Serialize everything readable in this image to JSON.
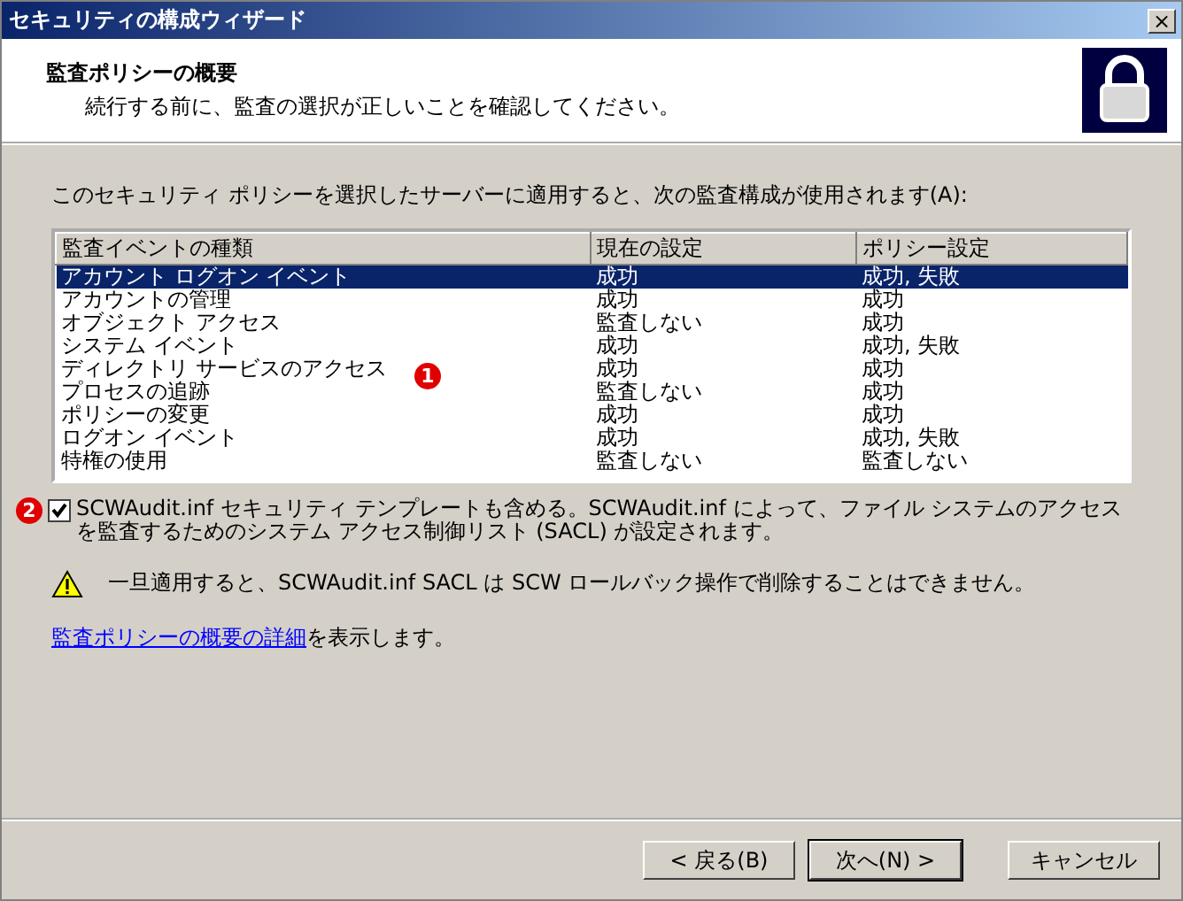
{
  "window": {
    "title": "セキュリティの構成ウィザード",
    "close": "×"
  },
  "header": {
    "title": "監査ポリシーの概要",
    "subtitle": "続行する前に、監査の選択が正しいことを確認してください。"
  },
  "intro": "このセキュリティ ポリシーを選択したサーバーに適用すると、次の監査構成が使用されます(A):",
  "table": {
    "columns": [
      "監査イベントの種類",
      "現在の設定",
      "ポリシー設定"
    ],
    "rows": [
      {
        "cells": [
          "アカウント ログオン イベント",
          "成功",
          "成功, 失敗"
        ],
        "selected": true
      },
      {
        "cells": [
          "アカウントの管理",
          "成功",
          "成功"
        ],
        "selected": false
      },
      {
        "cells": [
          "オブジェクト アクセス",
          "監査しない",
          "成功"
        ],
        "selected": false
      },
      {
        "cells": [
          "システム イベント",
          "成功",
          "成功, 失敗"
        ],
        "selected": false
      },
      {
        "cells": [
          "ディレクトリ サービスのアクセス",
          "成功",
          "成功"
        ],
        "selected": false
      },
      {
        "cells": [
          "プロセスの追跡",
          "監査しない",
          "成功"
        ],
        "selected": false
      },
      {
        "cells": [
          "ポリシーの変更",
          "成功",
          "成功"
        ],
        "selected": false
      },
      {
        "cells": [
          "ログオン イベント",
          "成功",
          "成功, 失敗"
        ],
        "selected": false
      },
      {
        "cells": [
          "特権の使用",
          "監査しない",
          "監査しない"
        ],
        "selected": false
      }
    ],
    "marker": "1"
  },
  "checkbox": {
    "marker": "2",
    "label": "SCWAudit.inf セキュリティ テンプレートも含める。SCWAudit.inf によって、ファイル システムのアクセスを監査するためのシステム アクセス制御リスト (SACL) が設定されます。",
    "checked": true
  },
  "warning": "一旦適用すると、SCWAudit.inf SACL は SCW ロールバック操作で削除することはできません。",
  "details": {
    "link": "監査ポリシーの概要の詳細",
    "text": "を表示します。"
  },
  "buttons": [
    {
      "label": "< 戻る(B)",
      "default": false
    },
    {
      "label": "次へ(N) >",
      "default": true
    },
    {
      "label": "キャンセル",
      "default": false
    }
  ]
}
